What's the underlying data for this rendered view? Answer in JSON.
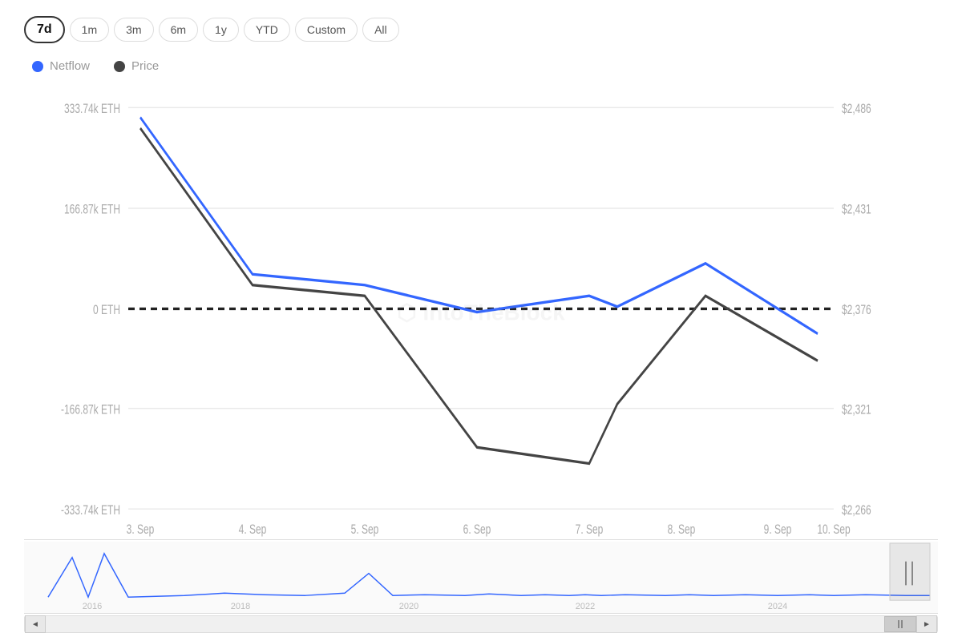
{
  "timeRange": {
    "buttons": [
      {
        "label": "7d",
        "active": true
      },
      {
        "label": "1m",
        "active": false
      },
      {
        "label": "3m",
        "active": false
      },
      {
        "label": "6m",
        "active": false
      },
      {
        "label": "1y",
        "active": false
      },
      {
        "label": "YTD",
        "active": false
      },
      {
        "label": "Custom",
        "active": false
      },
      {
        "label": "All",
        "active": false
      }
    ]
  },
  "legend": {
    "netflow_label": "Netflow",
    "price_label": "Price"
  },
  "chart": {
    "watermark": "IntoTheBlock",
    "left_axis": [
      {
        "value": "333.74k ETH",
        "y_pct": 5
      },
      {
        "value": "166.87k ETH",
        "y_pct": 27
      },
      {
        "value": "0 ETH",
        "y_pct": 49
      },
      {
        "value": "-166.87k ETH",
        "y_pct": 71
      },
      {
        "value": "-333.74k ETH",
        "y_pct": 93
      }
    ],
    "right_axis": [
      {
        "value": "$2,486",
        "y_pct": 5
      },
      {
        "value": "$2,431",
        "y_pct": 27
      },
      {
        "value": "$2,376",
        "y_pct": 49
      },
      {
        "value": "$2,321",
        "y_pct": 71
      },
      {
        "value": "$2,266",
        "y_pct": 93
      }
    ],
    "x_labels": [
      {
        "label": "3. Sep",
        "x_pct": 3
      },
      {
        "label": "4. Sep",
        "x_pct": 16
      },
      {
        "label": "5. Sep",
        "x_pct": 30
      },
      {
        "label": "6. Sep",
        "x_pct": 44
      },
      {
        "label": "7. Sep",
        "x_pct": 57
      },
      {
        "label": "8. Sep",
        "x_pct": 70
      },
      {
        "label": "9. Sep",
        "x_pct": 84
      },
      {
        "label": "10. Sep",
        "x_pct": 95
      }
    ]
  },
  "miniChart": {
    "year_labels": [
      {
        "label": "2016",
        "x_pct": 8
      },
      {
        "label": "2018",
        "x_pct": 24
      },
      {
        "label": "2020",
        "x_pct": 42
      },
      {
        "label": "2022",
        "x_pct": 62
      },
      {
        "label": "2024",
        "x_pct": 82
      }
    ]
  },
  "scrollbar": {
    "left_arrow": "◄",
    "right_arrow": "►"
  }
}
